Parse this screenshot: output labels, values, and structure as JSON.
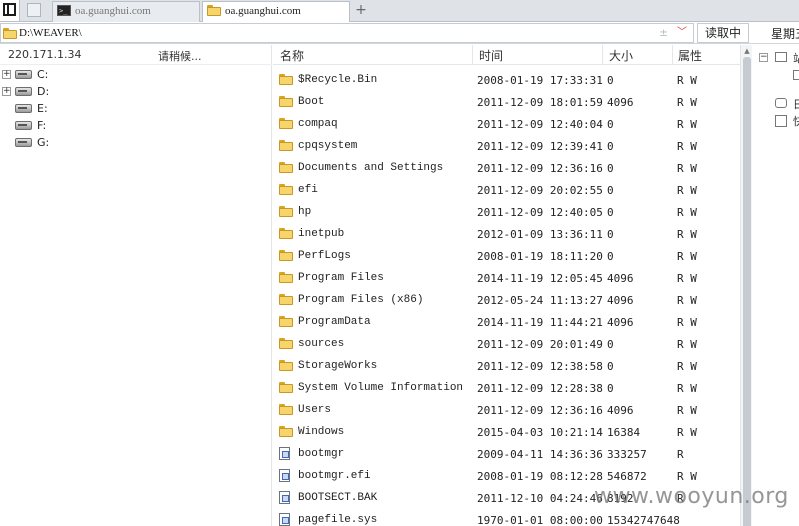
{
  "tabs": [
    {
      "label": "oa.guanghui.com",
      "icon": "terminal-icon",
      "active": false
    },
    {
      "label": "oa.guanghui.com",
      "icon": "folder-icon",
      "active": true
    }
  ],
  "tab_add_label": "+",
  "pathbar": {
    "path": "D:\\WEAVER\\",
    "separator": "±",
    "dropdown_glyph": "﹀",
    "read_button": "读取中",
    "weekday": "星期五"
  },
  "left_panel": {
    "host": "220.171.1.34",
    "status": "请稍候...",
    "drives": [
      {
        "label": "C:",
        "expandable": true
      },
      {
        "label": "D:",
        "expandable": true
      },
      {
        "label": "E:",
        "expandable": false
      },
      {
        "label": "F:",
        "expandable": false
      },
      {
        "label": "G:",
        "expandable": false
      }
    ]
  },
  "columns": {
    "name": "名称",
    "time": "时间",
    "size": "大小",
    "attr": "属性"
  },
  "files": [
    {
      "name": "$Recycle.Bin",
      "time": "2008-01-19 17:33:31",
      "size": "0",
      "attr": "R W",
      "type": "folder"
    },
    {
      "name": "Boot",
      "time": "2011-12-09 18:01:59",
      "size": "4096",
      "attr": "R W",
      "type": "folder"
    },
    {
      "name": "compaq",
      "time": "2011-12-09 12:40:04",
      "size": "0",
      "attr": "R W",
      "type": "folder"
    },
    {
      "name": "cpqsystem",
      "time": "2011-12-09 12:39:41",
      "size": "0",
      "attr": "R W",
      "type": "folder"
    },
    {
      "name": "Documents and Settings",
      "time": "2011-12-09 12:36:16",
      "size": "0",
      "attr": "R W",
      "type": "folder"
    },
    {
      "name": "efi",
      "time": "2011-12-09 20:02:55",
      "size": "0",
      "attr": "R W",
      "type": "folder"
    },
    {
      "name": "hp",
      "time": "2011-12-09 12:40:05",
      "size": "0",
      "attr": "R W",
      "type": "folder"
    },
    {
      "name": "inetpub",
      "time": "2012-01-09 13:36:11",
      "size": "0",
      "attr": "R W",
      "type": "folder"
    },
    {
      "name": "PerfLogs",
      "time": "2008-01-19 18:11:20",
      "size": "0",
      "attr": "R W",
      "type": "folder"
    },
    {
      "name": "Program Files",
      "time": "2014-11-19 12:05:45",
      "size": "4096",
      "attr": "R W",
      "type": "folder"
    },
    {
      "name": "Program Files (x86)",
      "time": "2012-05-24 11:13:27",
      "size": "4096",
      "attr": "R W",
      "type": "folder"
    },
    {
      "name": "ProgramData",
      "time": "2014-11-19 11:44:21",
      "size": "4096",
      "attr": "R W",
      "type": "folder"
    },
    {
      "name": "sources",
      "time": "2011-12-09 20:01:49",
      "size": "0",
      "attr": "R W",
      "type": "folder"
    },
    {
      "name": "StorageWorks",
      "time": "2011-12-09 12:38:58",
      "size": "0",
      "attr": "R W",
      "type": "folder"
    },
    {
      "name": "System Volume Information",
      "time": "2011-12-09 12:28:38",
      "size": "0",
      "attr": "R W",
      "type": "folder"
    },
    {
      "name": "Users",
      "time": "2011-12-09 12:36:16",
      "size": "4096",
      "attr": "R W",
      "type": "folder"
    },
    {
      "name": "Windows",
      "time": "2015-04-03 10:21:14",
      "size": "16384",
      "attr": "R W",
      "type": "folder"
    },
    {
      "name": "bootmgr",
      "time": "2009-04-11 14:36:36",
      "size": "333257",
      "attr": "R",
      "type": "file"
    },
    {
      "name": "bootmgr.efi",
      "time": "2008-01-19 08:12:28",
      "size": "546872",
      "attr": "R W",
      "type": "file"
    },
    {
      "name": "BOOTSECT.BAK",
      "time": "2011-12-10 04:24:46",
      "size": "8192",
      "attr": "R",
      "type": "file"
    },
    {
      "name": "pagefile.sys",
      "time": "1970-01-01 08:00:00",
      "size": "15342747648",
      "attr": "",
      "type": "file"
    }
  ],
  "right_panel": {
    "rows": [
      {
        "label": "站",
        "expander": "−"
      },
      {
        "label": "",
        "expander": ""
      },
      {
        "label": "日",
        "expander": ""
      },
      {
        "label": "快",
        "expander": ""
      }
    ]
  },
  "scroll_up_glyph": "▲",
  "watermark": "www.wooyun.org",
  "colors": {
    "folder": "#f6d56a",
    "tab_bar": "#dfe3e8",
    "accent_red": "#dd3333"
  }
}
